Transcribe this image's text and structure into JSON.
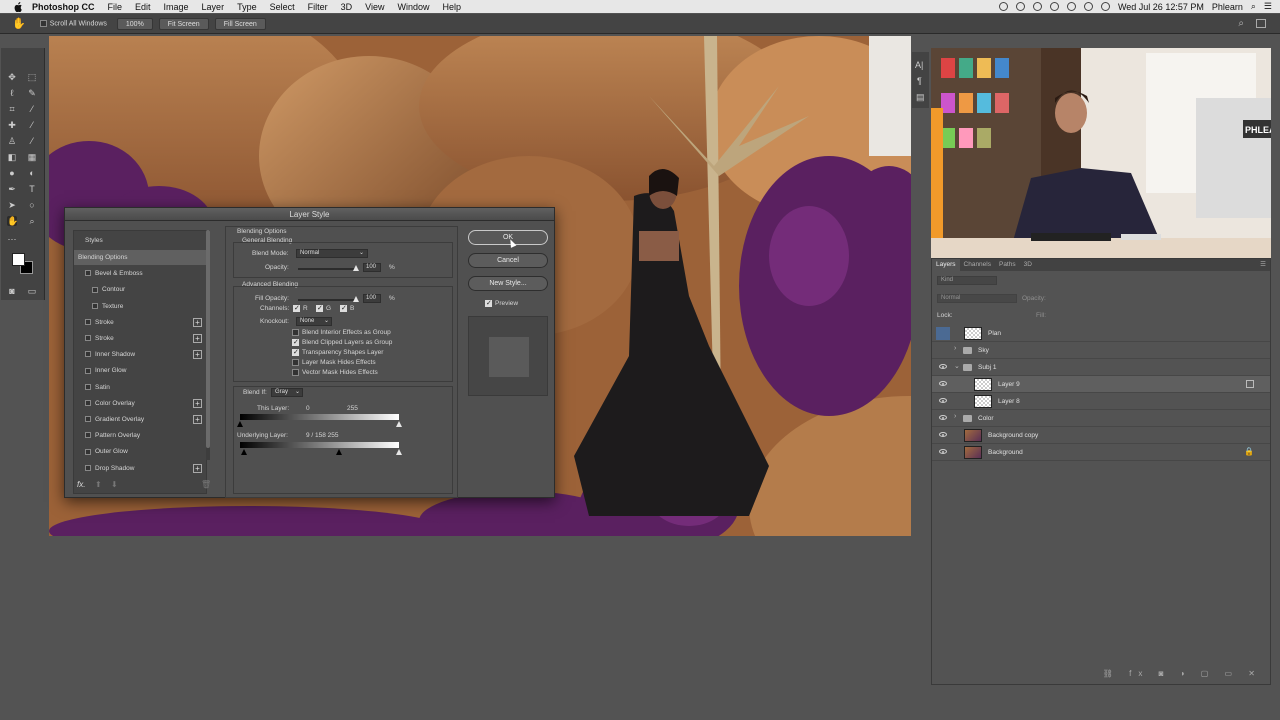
{
  "menubar": {
    "app_name": "Photoshop CC",
    "items": [
      "File",
      "Edit",
      "Image",
      "Layer",
      "Type",
      "Select",
      "Filter",
      "3D",
      "View",
      "Window",
      "Help"
    ],
    "clock": "Wed Jul 26  12:57 PM",
    "user": "Phlearn"
  },
  "options": {
    "scroll_all": "Scroll All Windows",
    "zoom": "100%",
    "fit_screen": "Fit Screen",
    "fill_screen": "Fill Screen"
  },
  "dialog": {
    "title": "Layer Style",
    "styles_header": "Styles",
    "styles": [
      {
        "label": "Blending Options",
        "checkbox": false,
        "plus": false,
        "selected": true
      },
      {
        "label": "Bevel & Emboss",
        "checkbox": true,
        "plus": false
      },
      {
        "label": "Contour",
        "checkbox": true,
        "plus": false,
        "indent": true
      },
      {
        "label": "Texture",
        "checkbox": true,
        "plus": false,
        "indent": true
      },
      {
        "label": "Stroke",
        "checkbox": true,
        "plus": true
      },
      {
        "label": "Stroke",
        "checkbox": true,
        "plus": true
      },
      {
        "label": "Inner Shadow",
        "checkbox": true,
        "plus": true
      },
      {
        "label": "Inner Glow",
        "checkbox": true,
        "plus": false
      },
      {
        "label": "Satin",
        "checkbox": true,
        "plus": false
      },
      {
        "label": "Color Overlay",
        "checkbox": true,
        "plus": true
      },
      {
        "label": "Gradient Overlay",
        "checkbox": true,
        "plus": true
      },
      {
        "label": "Pattern Overlay",
        "checkbox": true,
        "plus": false
      },
      {
        "label": "Outer Glow",
        "checkbox": true,
        "plus": false
      },
      {
        "label": "Drop Shadow",
        "checkbox": true,
        "plus": true
      }
    ],
    "fx_label": "fx.",
    "section_title": "Blending Options",
    "general_title": "General Blending",
    "blend_mode_label": "Blend Mode:",
    "blend_mode_value": "Normal",
    "opacity_label": "Opacity:",
    "opacity_value": "100",
    "percent": "%",
    "advanced_title": "Advanced Blending",
    "fill_opacity_label": "Fill Opacity:",
    "fill_opacity_value": "100",
    "channels_label": "Channels:",
    "channels": [
      "R",
      "G",
      "B"
    ],
    "knockout_label": "Knockout:",
    "knockout_value": "None",
    "adv_options": [
      {
        "label": "Blend Interior Effects as Group",
        "checked": false
      },
      {
        "label": "Blend Clipped Layers as Group",
        "checked": true
      },
      {
        "label": "Transparency Shapes Layer",
        "checked": true
      },
      {
        "label": "Layer Mask Hides Effects",
        "checked": false
      },
      {
        "label": "Vector Mask Hides Effects",
        "checked": false
      }
    ],
    "blend_if_label": "Blend If:",
    "blend_if_value": "Gray",
    "this_layer_label": "This Layer:",
    "this_layer_low": "0",
    "this_layer_high": "255",
    "underlying_label": "Underlying Layer:",
    "underlying_values": "9  /  158      255",
    "ok": "OK",
    "cancel": "Cancel",
    "new_style": "New Style...",
    "preview": "Preview"
  },
  "layers_panel": {
    "tabs": [
      "Layers",
      "Channels",
      "Paths",
      "3D"
    ],
    "kind": "Kind",
    "blend": "Normal",
    "opacity_label": "Opacity:",
    "lock_label": "Lock:",
    "fill_label": "Fill:",
    "layers": [
      {
        "name": "Plan",
        "type": "layer",
        "visible": false,
        "selected": false
      },
      {
        "name": "Sky",
        "type": "group",
        "visible": false
      },
      {
        "name": "Subj 1",
        "type": "group-open",
        "visible": true
      },
      {
        "name": "Layer 9",
        "type": "layer",
        "visible": true,
        "selected": true,
        "indent": true
      },
      {
        "name": "Layer 8",
        "type": "layer",
        "visible": true,
        "indent": true
      },
      {
        "name": "Color",
        "type": "group",
        "visible": true
      },
      {
        "name": "Background copy",
        "type": "photo",
        "visible": true
      },
      {
        "name": "Background",
        "type": "photo",
        "visible": true,
        "locked": true
      }
    ]
  },
  "video": {
    "sign_text": "PHLEA"
  }
}
